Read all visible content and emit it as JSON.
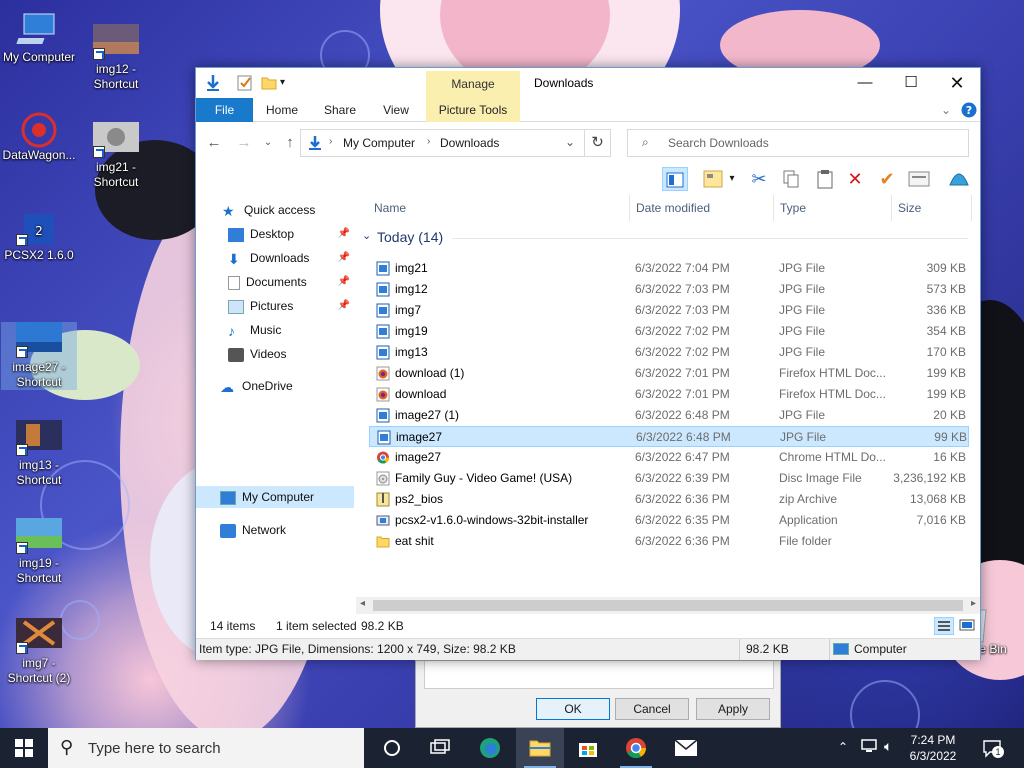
{
  "desktop": {
    "icons": [
      {
        "label": "My Computer"
      },
      {
        "label": "img12 -\nShortcut"
      },
      {
        "label": "DataWagon..."
      },
      {
        "label": "img21 -\nShortcut"
      },
      {
        "label": "PCSX2 1.6.0"
      },
      {
        "label": "image27 -\nShortcut"
      },
      {
        "label": "img13 -\nShortcut"
      },
      {
        "label": "img19 -\nShortcut"
      },
      {
        "label": "img7 -\nShortcut (2)"
      },
      {
        "label": "Recycle Bin"
      }
    ]
  },
  "dialog": {
    "ok": "OK",
    "cancel": "Cancel",
    "apply": "Apply"
  },
  "explorer": {
    "title": "Downloads",
    "manage_tab": "Manage",
    "ribbon_tabs": [
      "File",
      "Home",
      "Share",
      "View",
      "Picture Tools"
    ],
    "breadcrumb": [
      "My Computer",
      "Downloads"
    ],
    "search_placeholder": "Search Downloads",
    "nav": {
      "quick_access": "Quick access",
      "items": [
        "Desktop",
        "Downloads",
        "Documents",
        "Pictures",
        "Music",
        "Videos"
      ],
      "onedrive": "OneDrive",
      "my_computer": "My Computer",
      "network": "Network"
    },
    "columns": [
      "Name",
      "Date modified",
      "Type",
      "Size"
    ],
    "group": "Today (14)",
    "files": [
      {
        "name": "img21",
        "date": "6/3/2022 7:04 PM",
        "type": "JPG File",
        "size": "309 KB",
        "icon": "jpg"
      },
      {
        "name": "img12",
        "date": "6/3/2022 7:03 PM",
        "type": "JPG File",
        "size": "573 KB",
        "icon": "jpg"
      },
      {
        "name": "img7",
        "date": "6/3/2022 7:03 PM",
        "type": "JPG File",
        "size": "336 KB",
        "icon": "jpg"
      },
      {
        "name": "img19",
        "date": "6/3/2022 7:02 PM",
        "type": "JPG File",
        "size": "354 KB",
        "icon": "jpg"
      },
      {
        "name": "img13",
        "date": "6/3/2022 7:02 PM",
        "type": "JPG File",
        "size": "170 KB",
        "icon": "jpg"
      },
      {
        "name": "download (1)",
        "date": "6/3/2022 7:01 PM",
        "type": "Firefox HTML Doc...",
        "size": "199 KB",
        "icon": "firefox"
      },
      {
        "name": "download",
        "date": "6/3/2022 7:01 PM",
        "type": "Firefox HTML Doc...",
        "size": "199 KB",
        "icon": "firefox"
      },
      {
        "name": "image27 (1)",
        "date": "6/3/2022 6:48 PM",
        "type": "JPG File",
        "size": "20 KB",
        "icon": "jpg"
      },
      {
        "name": "image27",
        "date": "6/3/2022 6:48 PM",
        "type": "JPG File",
        "size": "99 KB",
        "icon": "jpg",
        "selected": true
      },
      {
        "name": "image27",
        "date": "6/3/2022 6:47 PM",
        "type": "Chrome HTML Do...",
        "size": "16 KB",
        "icon": "chrome"
      },
      {
        "name": "Family Guy - Video Game! (USA)",
        "date": "6/3/2022 6:39 PM",
        "type": "Disc Image File",
        "size": "3,236,192 KB",
        "icon": "disc"
      },
      {
        "name": "ps2_bios",
        "date": "6/3/2022 6:36 PM",
        "type": "zip Archive",
        "size": "13,068 KB",
        "icon": "zip"
      },
      {
        "name": "pcsx2-v1.6.0-windows-32bit-installer",
        "date": "6/3/2022 6:35 PM",
        "type": "Application",
        "size": "7,016 KB",
        "icon": "app"
      },
      {
        "name": "eat shit",
        "date": "6/3/2022 6:36 PM",
        "type": "File folder",
        "size": "",
        "icon": "folder"
      }
    ],
    "status": {
      "items": "14 items",
      "selected": "1 item selected",
      "selected_size": "98.2 KB"
    },
    "info": {
      "details": "Item type: JPG File, Dimensions: 1200 x 749, Size: 98.2 KB",
      "size": "98.2 KB",
      "location": "Computer"
    }
  },
  "taskbar": {
    "search_placeholder": "Type here to search",
    "time": "7:24 PM",
    "date": "6/3/2022",
    "notification_count": "1"
  }
}
